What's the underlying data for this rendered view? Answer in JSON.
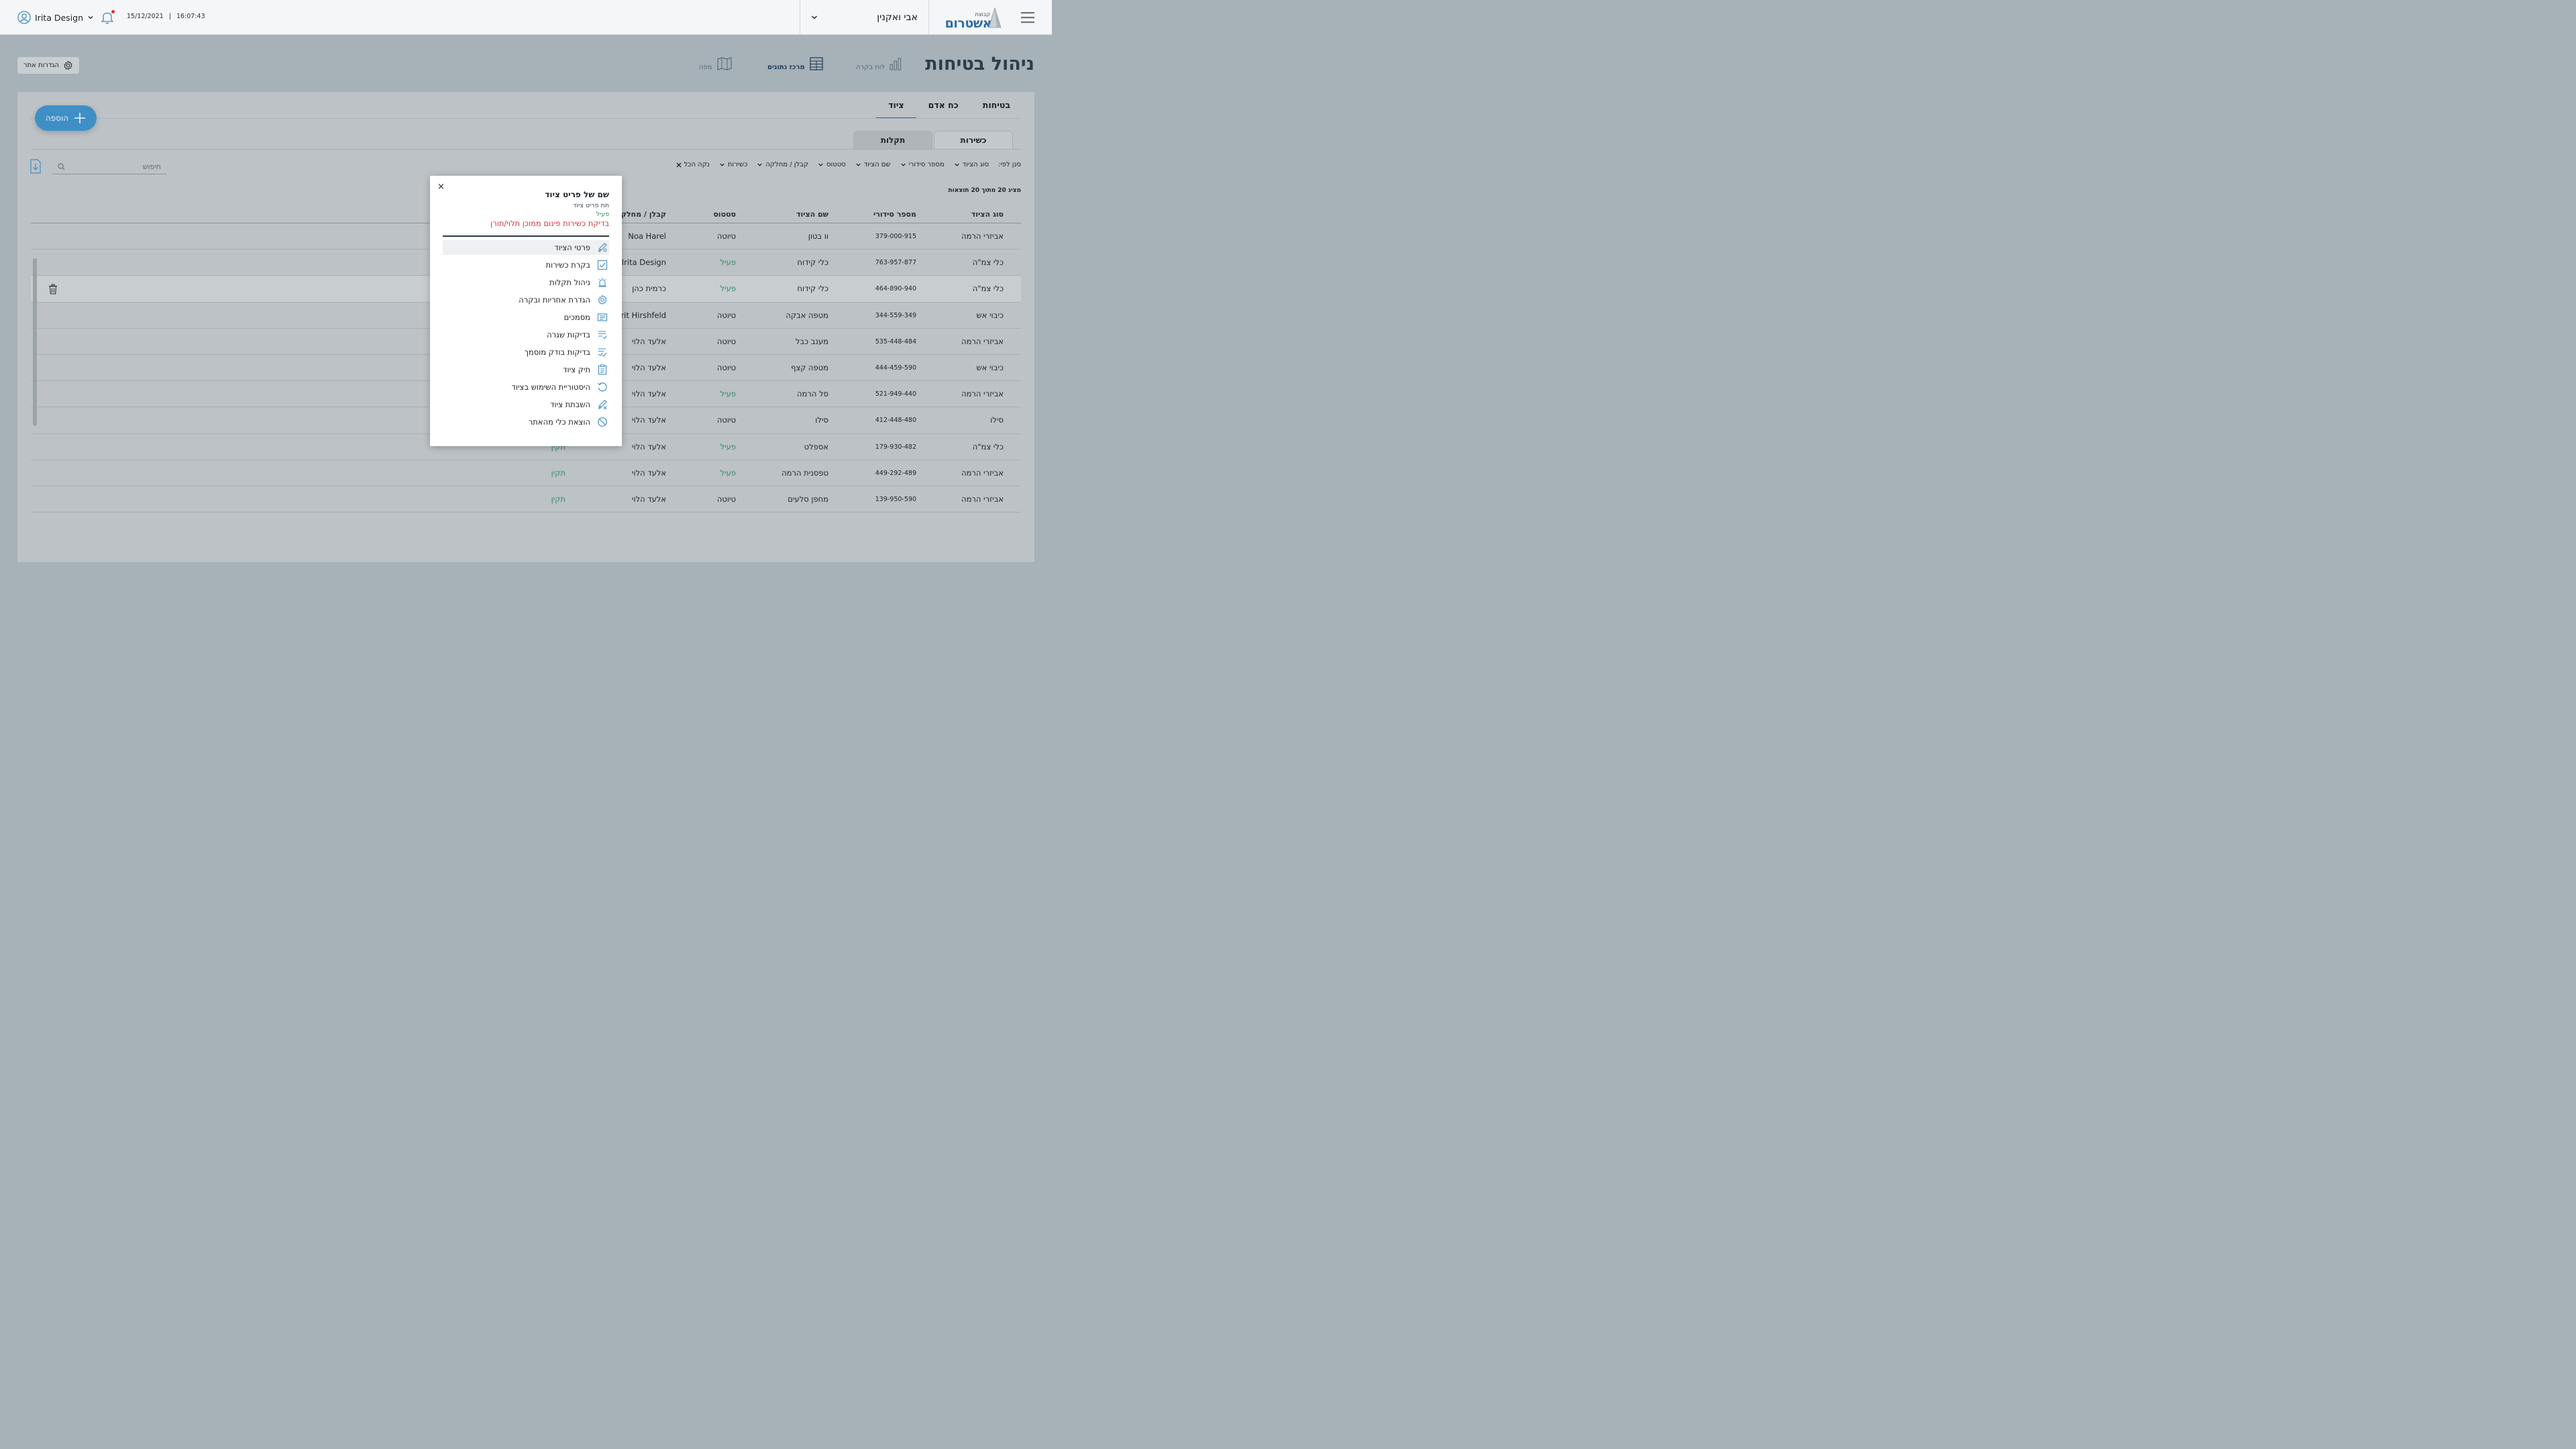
{
  "topbar": {
    "user_name": "Irita Design",
    "date": "15/12/2021",
    "separator": "|",
    "time": "16:07:43",
    "selected_user": "אבי ואקנין",
    "logo_small": "קבוצת",
    "logo_big": "אשטרום"
  },
  "header": {
    "title": "ניהול בטיחות",
    "nav": [
      {
        "label": "לוח בקרה",
        "icon": "bar-chart-icon"
      },
      {
        "label": "מרכז נתונים",
        "icon": "table-icon"
      },
      {
        "label": "מפה",
        "icon": "map-icon"
      }
    ],
    "settings_label": "הגדרות אתר"
  },
  "tabs": [
    "בטיחות",
    "כח אדם",
    "ציוד"
  ],
  "add_label": "הוספה",
  "sub_tabs": [
    "כשירות",
    "תקלות"
  ],
  "filters": {
    "label": "סנן לפי:",
    "items": [
      "סוג הציוד",
      "מספר סידורי",
      "שם הציוד",
      "סטטוס",
      "קבלן / מחלקה",
      "כשירות"
    ],
    "clear": "נקה הכל"
  },
  "search_placeholder": "חיפוש",
  "results_text": "מציג 20 מתוך 20 תוצאות",
  "table": {
    "headers": [
      "סוג הציוד",
      "מספר סידורי",
      "שם הציוד",
      "סטטוס",
      "קבלן / מחלקה"
    ],
    "rows": [
      {
        "type": "אביזרי הרמה",
        "serial": "379-000-915",
        "name": "וו בטון",
        "status": "טיוטה",
        "contractor": "Noa Harel",
        "extra": ""
      },
      {
        "type": "כלי צמ\"ה",
        "serial": "763-957-877",
        "name": "כלי קידוח",
        "status": "פעיל",
        "contractor": "Irita Design",
        "extra": ""
      },
      {
        "type": "כלי צמ\"ה",
        "serial": "464-890-940",
        "name": "כלי קידוח",
        "status": "פעיל",
        "contractor": "כרמית כהן",
        "extra": ""
      },
      {
        "type": "כיבוי אש",
        "serial": "344-559-349",
        "name": "מטפה אבקה",
        "status": "טיוטה",
        "contractor": "Orit Hirshfeld",
        "extra": ""
      },
      {
        "type": "אביזרי הרמה",
        "serial": "535-448-484",
        "name": "מענב כבל",
        "status": "טיוטה",
        "contractor": "אלעד הלוי",
        "extra": ""
      },
      {
        "type": "כיבוי אש",
        "serial": "444-459-590",
        "name": "מטפה קצף",
        "status": "טיוטה",
        "contractor": "אלעד הלוי",
        "extra": ""
      },
      {
        "type": "אביזרי הרמה",
        "serial": "521-949-440",
        "name": "סל הרמה",
        "status": "פעיל",
        "contractor": "אלעד הלוי",
        "extra": ""
      },
      {
        "type": "סילו",
        "serial": "412-448-480",
        "name": "סילו",
        "status": "טיוטה",
        "contractor": "אלעד הלוי",
        "extra": ""
      },
      {
        "type": "כלי צמ\"ה",
        "serial": "179-930-482",
        "name": "אספלט",
        "status": "פעיל",
        "contractor": "אלעד הלוי",
        "extra": "תקין"
      },
      {
        "type": "אביזרי הרמה",
        "serial": "449-292-489",
        "name": "טפסנית הרמה",
        "status": "פעיל",
        "contractor": "אלעד הלוי",
        "extra": "תקין"
      },
      {
        "type": "אביזרי הרמה",
        "serial": "139-950-590",
        "name": "מחפן סלעים",
        "status": "טיוטה",
        "contractor": "אלעד הלוי",
        "extra": "תקין"
      }
    ]
  },
  "modal": {
    "close": "×",
    "title": "שם של פריט ציוד",
    "subtitle": "תת פריט ציוד",
    "status": "פעיל",
    "warning": "בדיקת כשירות פינום ממוכן תלוי/תורן",
    "items": [
      {
        "label": "פרטי הציוד",
        "icon": "equipment-icon"
      },
      {
        "label": "בקרת כשירות",
        "icon": "checkbox-icon"
      },
      {
        "label": "ניהול תקלות",
        "icon": "alarm-icon"
      },
      {
        "label": "הגדרת אחריות ובקרה",
        "icon": "gear-icon"
      },
      {
        "label": "מסמכים",
        "icon": "document-icon"
      },
      {
        "label": "בדיקות שגרה",
        "icon": "checklist-icon"
      },
      {
        "label": "בדיקות בודק מוסמך",
        "icon": "certified-check-icon"
      },
      {
        "label": "תיק ציוד",
        "icon": "clipboard-icon"
      },
      {
        "label": "היסטוריית השימוש בציוד",
        "icon": "history-icon"
      },
      {
        "label": "השבתת ציוד",
        "icon": "disable-equipment-icon"
      },
      {
        "label": "הוצאת כלי מהאתר",
        "icon": "block-icon"
      }
    ]
  }
}
